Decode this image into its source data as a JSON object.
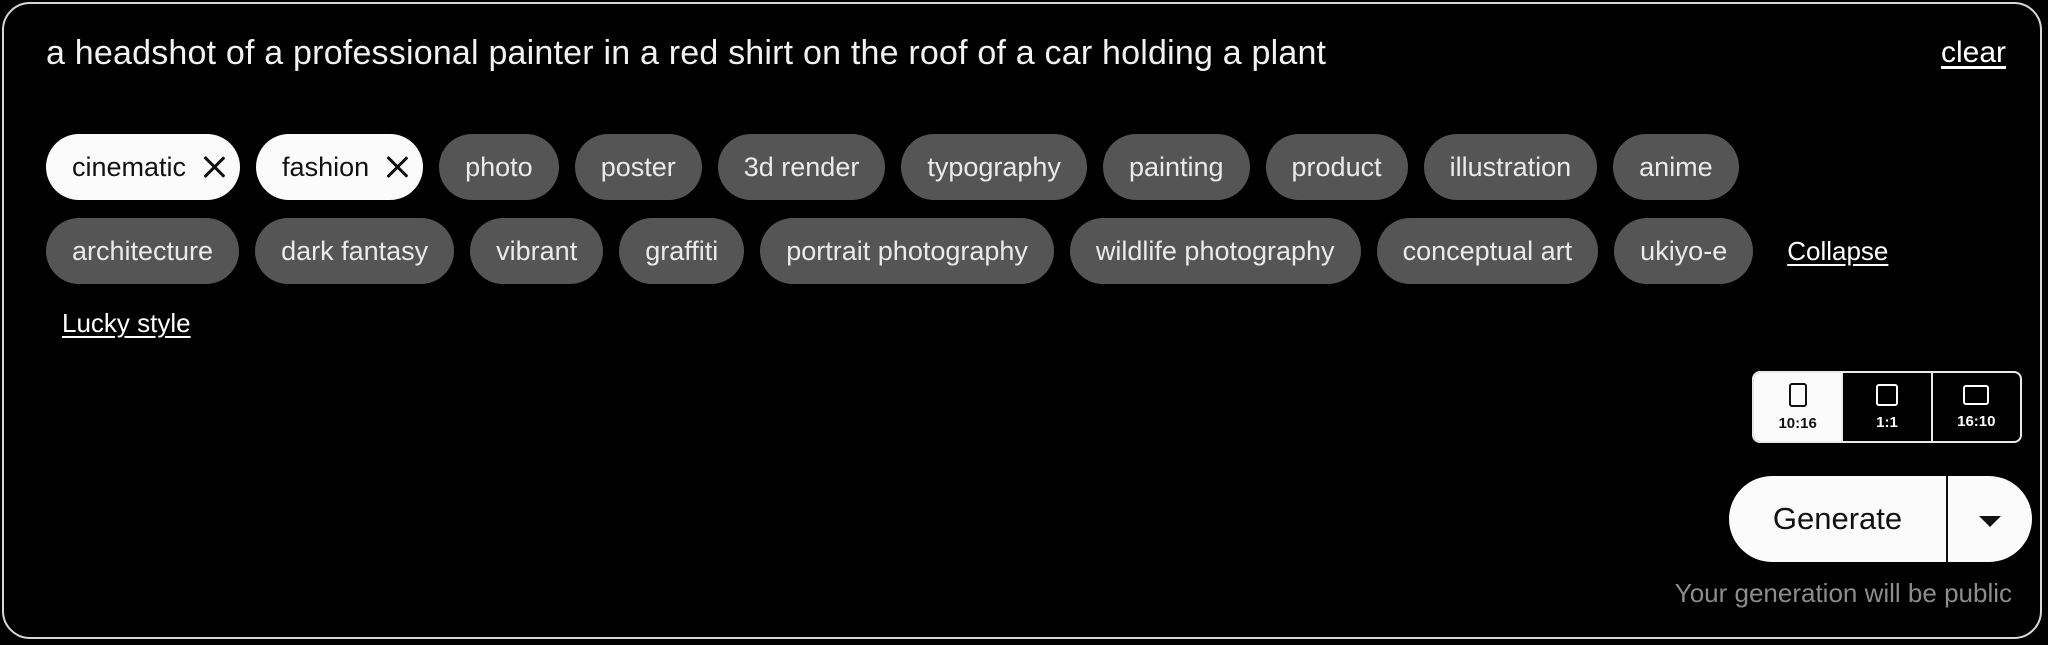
{
  "prompt": {
    "text": "a headshot of a professional painter in a red shirt on the roof of a car holding a plant",
    "clear_label": "clear"
  },
  "styles": {
    "row1": [
      {
        "label": "cinematic",
        "selected": true
      },
      {
        "label": "fashion",
        "selected": true
      },
      {
        "label": "photo",
        "selected": false
      },
      {
        "label": "poster",
        "selected": false
      },
      {
        "label": "3d render",
        "selected": false
      },
      {
        "label": "typography",
        "selected": false
      },
      {
        "label": "painting",
        "selected": false
      },
      {
        "label": "product",
        "selected": false
      },
      {
        "label": "illustration",
        "selected": false
      },
      {
        "label": "anime",
        "selected": false
      }
    ],
    "row2": [
      {
        "label": "architecture",
        "selected": false
      },
      {
        "label": "dark fantasy",
        "selected": false
      },
      {
        "label": "vibrant",
        "selected": false
      },
      {
        "label": "graffiti",
        "selected": false
      },
      {
        "label": "portrait photography",
        "selected": false
      },
      {
        "label": "wildlife photography",
        "selected": false
      },
      {
        "label": "conceptual art",
        "selected": false
      },
      {
        "label": "ukiyo-e",
        "selected": false
      }
    ],
    "collapse_label": "Collapse",
    "lucky_label": "Lucky style"
  },
  "aspect_ratios": {
    "options": [
      {
        "label": "10:16",
        "icon": "portrait-ratio-icon",
        "selected": true
      },
      {
        "label": "1:1",
        "icon": "square-ratio-icon",
        "selected": false
      },
      {
        "label": "16:10",
        "icon": "landscape-ratio-icon",
        "selected": false
      }
    ]
  },
  "generate": {
    "label": "Generate",
    "dropdown_icon": "caret-down-icon",
    "note": "Your generation will be public"
  },
  "colors": {
    "background": "#000000",
    "chip": "#555555",
    "chip_selected": "#fbfbfb",
    "border": "#d8d8d8",
    "note_text": "#8c8c8c"
  }
}
